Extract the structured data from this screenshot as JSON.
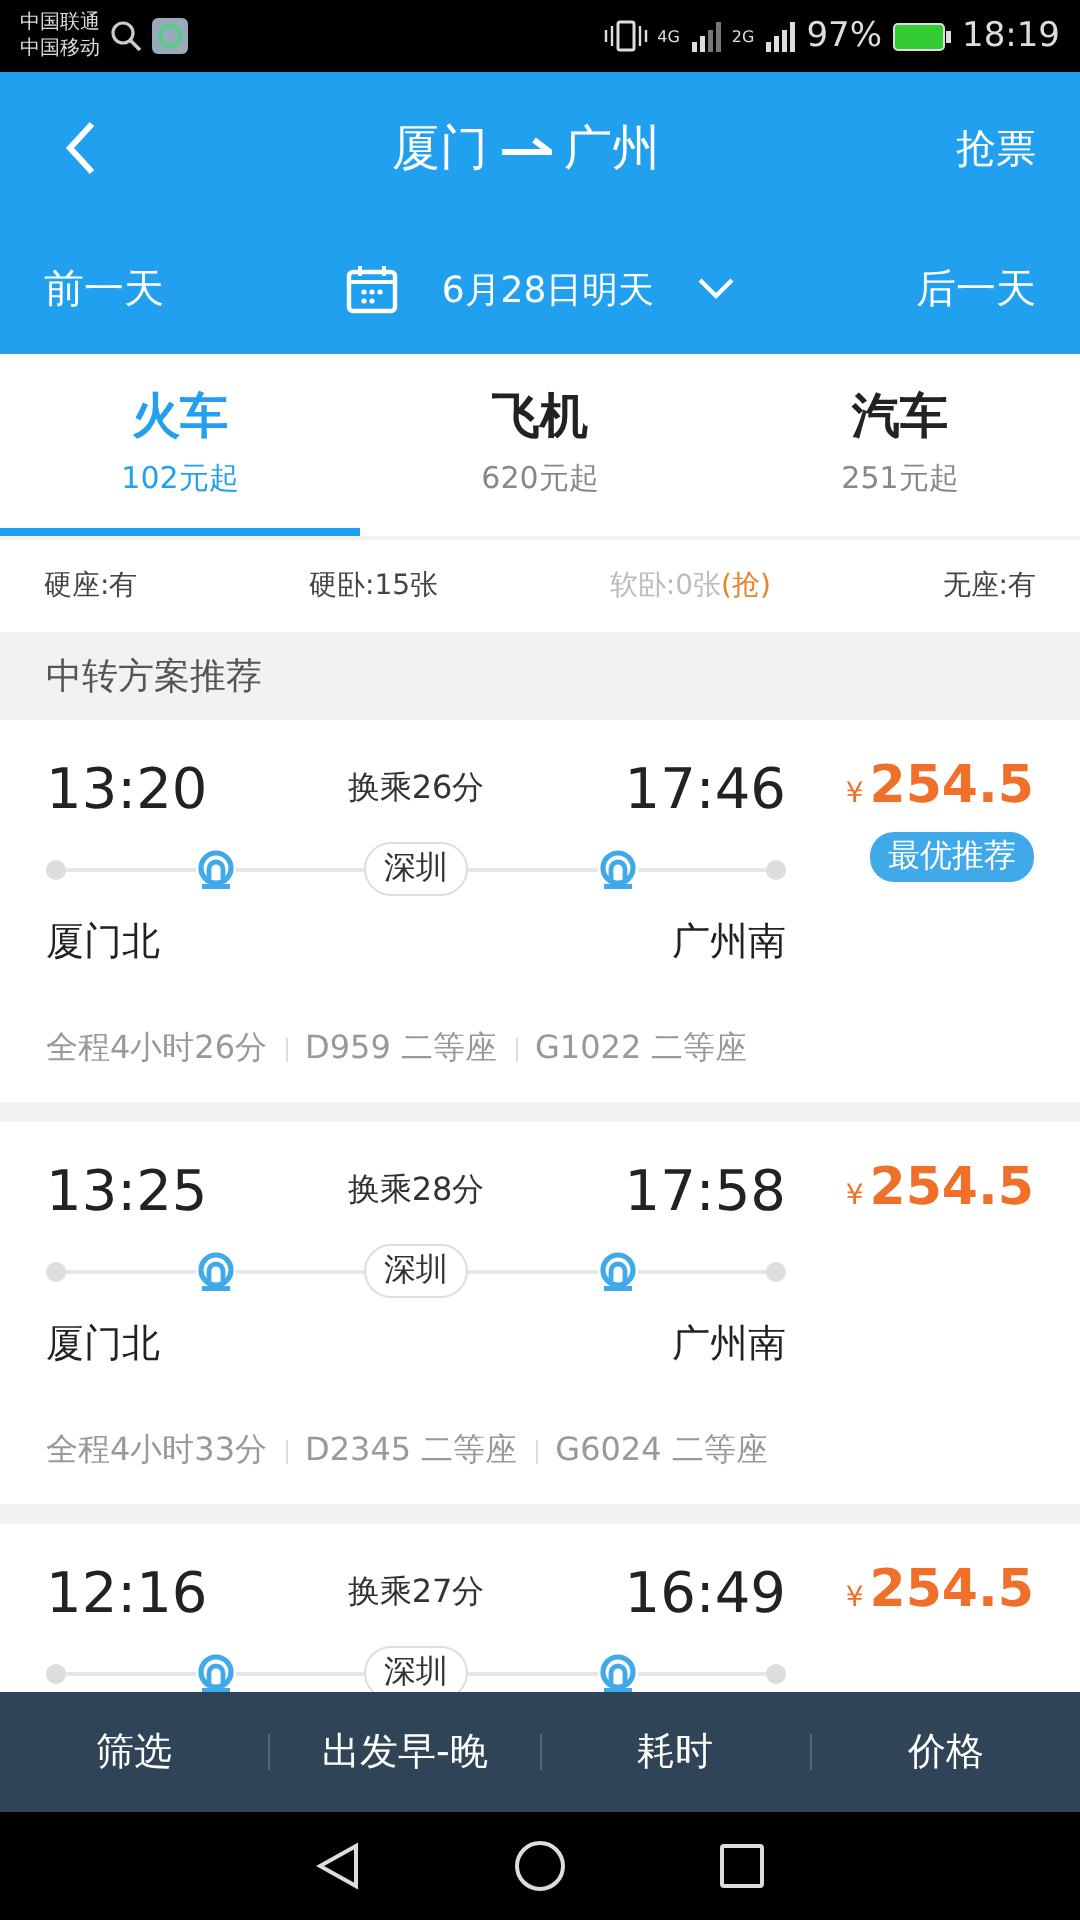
{
  "status_bar": {
    "carriers": [
      "中国联通",
      "中国移动"
    ],
    "network_1": "4G",
    "network_2": "2G",
    "battery": "97%",
    "time": "18:19"
  },
  "header": {
    "title_from": "厦门",
    "title_to": "广州",
    "action": "抢票"
  },
  "date_bar": {
    "prev": "前一天",
    "date": "6月28日明天",
    "next": "后一天"
  },
  "tabs": [
    {
      "label": "火车",
      "price": "102元起",
      "selected": true
    },
    {
      "label": "飞机",
      "price": "620元起",
      "selected": false
    },
    {
      "label": "汽车",
      "price": "251元起",
      "selected": false
    }
  ],
  "seats": [
    {
      "label": "硬座:有",
      "available": true
    },
    {
      "label": "硬卧:15张",
      "available": true
    },
    {
      "label": "软卧:0张",
      "available": false,
      "action": "(抢)"
    },
    {
      "label": "无座:有",
      "available": true
    }
  ],
  "section_title": "中转方案推荐",
  "plans": [
    {
      "depart": "13:20",
      "transfer": "换乘26分",
      "arrive": "17:46",
      "currency": "¥",
      "price": "254.5",
      "badge": "最优推荐",
      "via": "深圳",
      "from": "厦门北",
      "to": "广州南",
      "summary": [
        "全程4小时26分",
        "D959 二等座",
        "G1022 二等座"
      ]
    },
    {
      "depart": "13:25",
      "transfer": "换乘28分",
      "arrive": "17:58",
      "currency": "¥",
      "price": "254.5",
      "via": "深圳",
      "from": "厦门北",
      "to": "广州南",
      "summary": [
        "全程4小时33分",
        "D2345 二等座",
        "G6024 二等座"
      ]
    },
    {
      "depart": "12:16",
      "transfer": "换乘27分",
      "arrive": "16:49",
      "currency": "¥",
      "price": "254.5",
      "via": "深圳"
    }
  ],
  "bottom_bar": [
    "筛选",
    "出发早-晚",
    "耗时",
    "价格"
  ]
}
